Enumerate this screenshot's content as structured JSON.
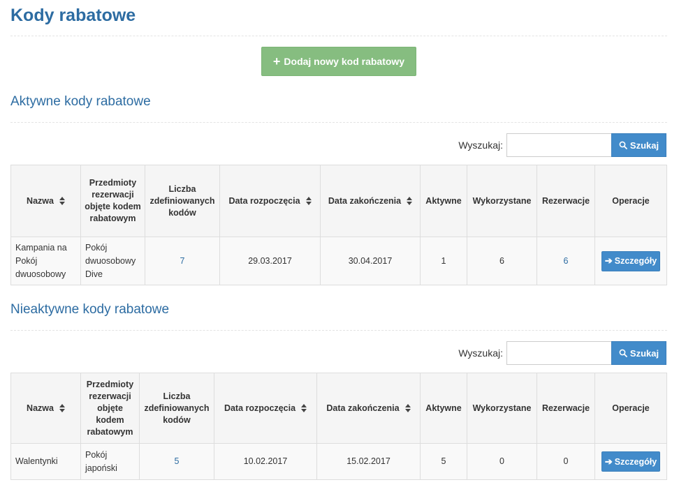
{
  "page": {
    "title": "Kody rabatowe",
    "add_button": "Dodaj nowy kod rabatowy"
  },
  "columns": {
    "name": "Nazwa",
    "items": "Przedmioty rezerwacji objęte kodem rabatowym",
    "count": "Liczba zdefiniowanych kodów",
    "start": "Data rozpoczęcia",
    "end": "Data zakończenia",
    "active": "Aktywne",
    "used": "Wykorzystane",
    "reservations": "Rezerwacje",
    "operations": "Operacje"
  },
  "search": {
    "label": "Wyszukaj:",
    "button": "Szukaj",
    "value": ""
  },
  "details_label": "Szczegóły",
  "active_section": {
    "title": "Aktywne kody rabatowe",
    "rows": [
      {
        "name": "Kampania na Pokój dwuosobowy",
        "items": "Pokój dwuosobowy Dive",
        "count": "7",
        "start": "29.03.2017",
        "end": "30.04.2017",
        "active": "1",
        "used": "6",
        "reservations": "6"
      }
    ]
  },
  "inactive_section": {
    "title": "Nieaktywne kody rabatowe",
    "rows": [
      {
        "name": "Walentynki",
        "items": "Pokój japoński",
        "count": "5",
        "start": "10.02.2017",
        "end": "15.02.2017",
        "active": "5",
        "used": "0",
        "reservations": "0"
      }
    ]
  }
}
